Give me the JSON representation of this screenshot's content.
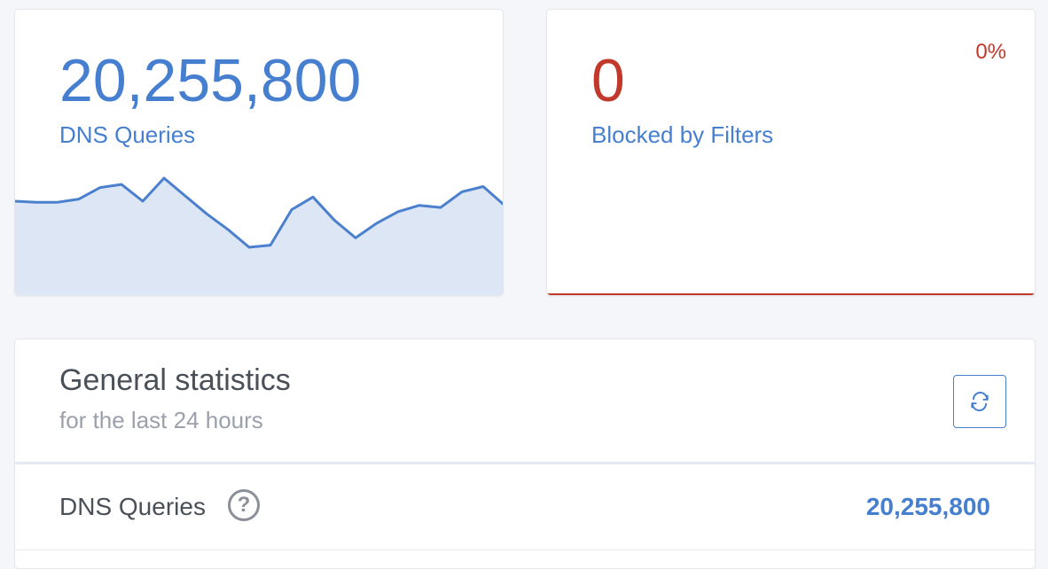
{
  "colors": {
    "accent": "#467fcf",
    "danger": "#c0392b",
    "chart_fill": "#dde6f4",
    "chart_line": "#4a80cd",
    "muted": "#9aa0ac",
    "text": "#495057"
  },
  "queries_card": {
    "value": "20,255,800",
    "label": "DNS Queries",
    "sparkline": [
      10,
      9,
      9,
      12,
      23,
      26,
      10,
      32,
      15,
      -2,
      -17,
      -34,
      -32,
      2,
      14,
      -8,
      -25,
      -11,
      0,
      6,
      4,
      19,
      24,
      6
    ]
  },
  "blocked_card": {
    "value": "0",
    "label": "Blocked by Filters",
    "percent": "0%"
  },
  "general": {
    "title": "General statistics",
    "subtitle": "for the last 24 hours",
    "refresh_icon": "refresh-icon",
    "rows": [
      {
        "label": "DNS Queries",
        "value": "20,255,800",
        "icon": "help-icon"
      }
    ]
  }
}
